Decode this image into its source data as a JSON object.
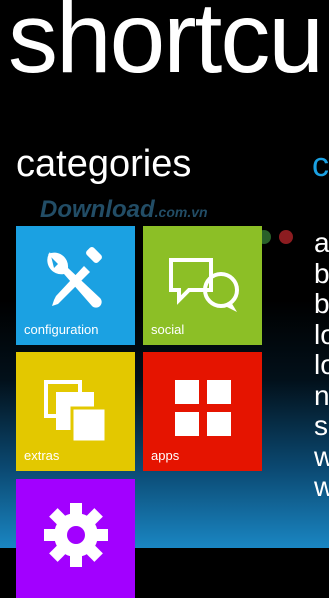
{
  "app": {
    "title": "shortcu"
  },
  "categories": {
    "heading": "categories"
  },
  "next_panel": {
    "heading": "c"
  },
  "watermark": {
    "text": "Download",
    "suffix": ".com.vn"
  },
  "dot_colors": [
    "#2aa9a0",
    "#7aa840",
    "#b9b63a",
    "#d48a1e",
    "#cc4a2a",
    "#3a8a3a",
    "#c8282d"
  ],
  "tiles": [
    {
      "id": "configuration",
      "label": "configuration",
      "color": "#1ba1e2",
      "icon": "tools-icon"
    },
    {
      "id": "social",
      "label": "social",
      "color": "#8cbf26",
      "icon": "chat-bubbles-icon"
    },
    {
      "id": "extras",
      "label": "extras",
      "color": "#e3c800",
      "icon": "stacked-squares-icon"
    },
    {
      "id": "apps",
      "label": "apps",
      "color": "#e51400",
      "icon": "app-grid-icon"
    },
    {
      "id": "settings",
      "label": "",
      "color": "#a200ff",
      "icon": "gear-icon"
    }
  ],
  "shortcut_list": [
    "a",
    "b",
    "b",
    "lo",
    "lo",
    "n",
    "s",
    "w",
    "w"
  ]
}
